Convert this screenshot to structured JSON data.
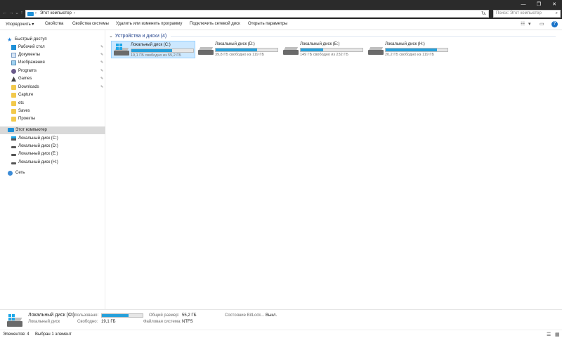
{
  "window": {
    "minimize": "—",
    "maximize": "❐",
    "close": "✕"
  },
  "nav": {
    "back": "←",
    "forward": "→",
    "dropdown": "⌄",
    "up": "↑"
  },
  "address": {
    "crumb": "Этот компьютер",
    "refresh": "↻"
  },
  "search": {
    "placeholder": "Поиск: Этот компьютер",
    "icon": "⌕"
  },
  "commands": {
    "organize": "Упорядочить ▾",
    "properties": "Свойства",
    "system_properties": "Свойства системы",
    "uninstall": "Удалить или изменить программу",
    "map_drive": "Подключить сетевой диск",
    "open_settings": "Открыть параметры",
    "view_icon": "☷",
    "view_dd": "▾",
    "pane_icon": "▭",
    "help": "?"
  },
  "sidebar": {
    "quick_access": "Быстрый доступ",
    "pinned": [
      {
        "label": "Рабочий стол",
        "icon": "desktop-icon"
      },
      {
        "label": "Документы",
        "icon": "documents-icon"
      },
      {
        "label": "Изображения",
        "icon": "pictures-icon"
      },
      {
        "label": "Programs",
        "icon": "programs-icon"
      },
      {
        "label": "Games",
        "icon": "games-icon"
      },
      {
        "label": "Downloads",
        "icon": "downloads-icon"
      }
    ],
    "pin_glyph": "📌",
    "folders": [
      "Capture",
      "etc",
      "Saves",
      "Проекты"
    ],
    "this_pc": "Этот компьютер",
    "drives": [
      "Локальный диск (C:)",
      "Локальный диск (D:)",
      "Локальный диск (E:)",
      "Локальный диск (H:)"
    ],
    "network": "Сеть"
  },
  "group": {
    "chevron": "⌄",
    "title": "Устройства и диски (4)"
  },
  "drives": [
    {
      "name": "Локальный диск (C:)",
      "info": "19,1 ГБ свободно из 55,2 ГБ",
      "used_fraction": 0.654,
      "system": true
    },
    {
      "name": "Локальный диск (D:)",
      "info": "39,8 ГБ свободно из 119 ГБ",
      "used_fraction": 0.666,
      "system": false
    },
    {
      "name": "Локальный диск (E:)",
      "info": "149 ГБ свободно из 232 ГБ",
      "used_fraction": 0.358,
      "system": false
    },
    {
      "name": "Локальный диск (H:)",
      "info": "20,2 ГБ свободно из 119 ГБ",
      "used_fraction": 0.83,
      "system": false
    }
  ],
  "details": {
    "name": "Локальный диск (C:)",
    "type": "Локальный диск",
    "used_label": "Использовано:",
    "used_fraction": 0.654,
    "free_label": "Свободно:",
    "free_value": "19,1 ГБ",
    "total_label": "Общий размер:",
    "total_value": "55,2 ГБ",
    "fs_label": "Файловая система:",
    "fs_value": "NTFS",
    "bitlocker_label": "Состояние BitLock...",
    "bitlocker_value": "Выкл."
  },
  "status": {
    "items": "Элементов: 4",
    "selected": "Выбран 1 элемент",
    "details_view": "☰",
    "tiles_view": "▦"
  },
  "colors": {
    "accent": "#26a0da",
    "selection": "#cce8ff",
    "titlebar": "#2b2b2b"
  }
}
